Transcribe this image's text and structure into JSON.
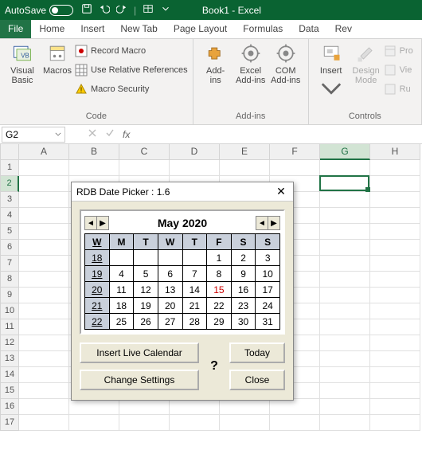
{
  "titlebar": {
    "autosave_label": "AutoSave",
    "autosave_state_text": "Off",
    "book_title": "Book1 - Excel"
  },
  "menubar": {
    "file": "File",
    "items": [
      "Home",
      "Insert",
      "New Tab",
      "Page Layout",
      "Formulas",
      "Data",
      "Rev"
    ]
  },
  "ribbon": {
    "code": {
      "visual_basic": "Visual\nBasic",
      "macros": "Macros",
      "record_macro": "Record Macro",
      "use_relative": "Use Relative References",
      "macro_security": "Macro Security",
      "group_label": "Code"
    },
    "addins": {
      "addins": "Add-\nins",
      "excel_addins": "Excel\nAdd-ins",
      "com_addins": "COM\nAdd-ins",
      "group_label": "Add-ins"
    },
    "controls": {
      "insert": "Insert",
      "design_mode": "Design\nMode",
      "properties_short": "Pro",
      "view_code_short": "Vie",
      "run_short": "Ru",
      "group_label": "Controls"
    }
  },
  "namebox": {
    "value": "G2",
    "fx_label": "fx"
  },
  "columns": [
    "A",
    "B",
    "C",
    "D",
    "E",
    "F",
    "G",
    "H"
  ],
  "rows": [
    "1",
    "2",
    "3",
    "4",
    "5",
    "6",
    "7",
    "8",
    "9",
    "10",
    "11",
    "12",
    "13",
    "14",
    "15",
    "16",
    "17"
  ],
  "selected": {
    "col_index": 6,
    "row_index": 1
  },
  "dialog": {
    "title": "RDB Date Picker : 1.6",
    "month_label": "May 2020",
    "dow": [
      "W",
      "M",
      "T",
      "W",
      "T",
      "F",
      "S",
      "S"
    ],
    "weeks": [
      {
        "wk": "18",
        "days": [
          "",
          "",
          "",
          "",
          "1",
          "2",
          "3"
        ]
      },
      {
        "wk": "19",
        "days": [
          "4",
          "5",
          "6",
          "7",
          "8",
          "9",
          "10"
        ]
      },
      {
        "wk": "20",
        "days": [
          "11",
          "12",
          "13",
          "14",
          "15",
          "16",
          "17"
        ]
      },
      {
        "wk": "21",
        "days": [
          "18",
          "19",
          "20",
          "21",
          "22",
          "23",
          "24"
        ]
      },
      {
        "wk": "22",
        "days": [
          "25",
          "26",
          "27",
          "28",
          "29",
          "30",
          "31"
        ]
      }
    ],
    "today_highlight": "15",
    "buttons": {
      "insert_live": "Insert Live Calendar",
      "change_settings": "Change Settings",
      "today": "Today",
      "close": "Close",
      "help": "?"
    }
  }
}
